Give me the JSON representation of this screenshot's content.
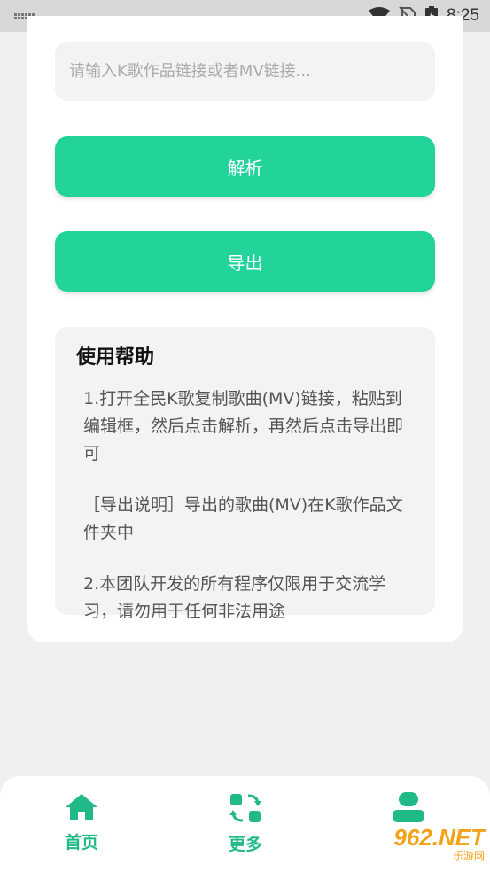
{
  "status_bar": {
    "time": "8:25"
  },
  "search": {
    "placeholder": "请输入K歌作品链接或者MV链接..."
  },
  "buttons": {
    "parse_label": "解析",
    "export_label": "导出"
  },
  "help": {
    "title": "使用帮助",
    "paragraphs": [
      "1.打开全民K歌复制歌曲(MV)链接，粘贴到编辑框，然后点击解析，再然后点击导出即可",
      "［导出说明］导出的歌曲(MV)在K歌作品文件夹中",
      "2.本团队开发的所有程序仅限用于交流学习，请勿用于任何非法用途"
    ]
  },
  "nav": {
    "items": [
      {
        "label": "首页",
        "icon": "home-icon"
      },
      {
        "label": "更多",
        "icon": "more-icon"
      },
      {
        "label": "",
        "icon": "user-icon"
      }
    ]
  },
  "watermark": {
    "main": "962.NET",
    "sub": "乐游网"
  },
  "colors": {
    "accent": "#22d39a",
    "nav_accent": "#22b988",
    "background": "#f0f1ef"
  }
}
